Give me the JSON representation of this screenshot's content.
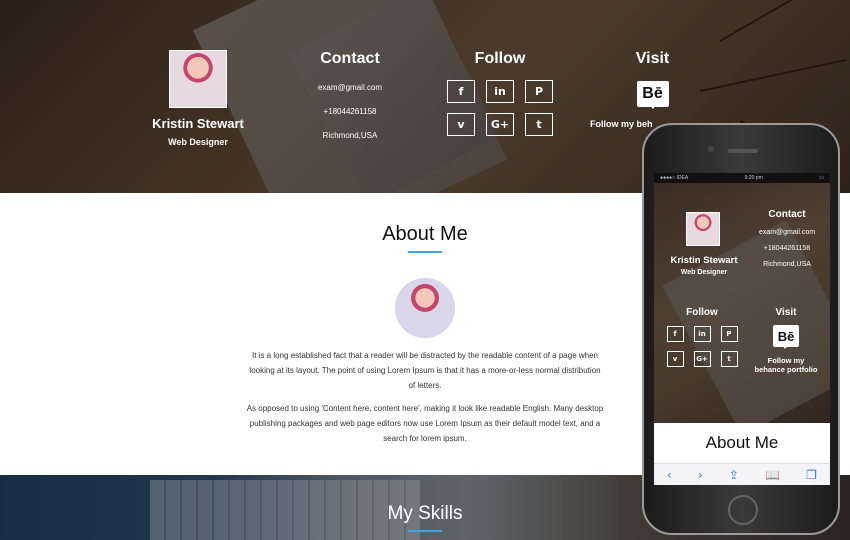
{
  "profile": {
    "name": "Kristin Stewart",
    "role": "Web Designer"
  },
  "contact": {
    "title": "Contact",
    "email": "exam@gmail.com",
    "phone": "+18044261158",
    "location": "Richmond,USA"
  },
  "follow": {
    "title": "Follow",
    "icons": [
      {
        "name": "facebook-icon",
        "glyph": "f"
      },
      {
        "name": "linkedin-icon",
        "glyph": "in"
      },
      {
        "name": "pinterest-icon",
        "glyph": "P"
      },
      {
        "name": "vimeo-icon",
        "glyph": "v"
      },
      {
        "name": "google-plus-icon",
        "glyph": "G+"
      },
      {
        "name": "tumblr-icon",
        "glyph": "t"
      }
    ]
  },
  "visit": {
    "title": "Visit",
    "badge": "Bē",
    "caption": "Follow my behance portfolio",
    "caption_cropped": "Follow my beh"
  },
  "about": {
    "title": "About Me",
    "paragraph1": "It is a long established fact that a reader will be distracted by the readable content of a page when looking at its layout. The point of using Lorem Ipsum is that it has a more-or-less normal distribution of letters.",
    "paragraph2": "As opposed to using 'Content here, content here', making it look like readable English. Many desktop publishing packages and web page editors now use Lorem Ipsum as their default model text, and a search for lorem ipsum."
  },
  "skills": {
    "title": "My Skills"
  },
  "phone": {
    "status_left": "●●●●○ IDEA",
    "status_time": "9:20 pm",
    "mobile_caption_line1": "Follow my",
    "mobile_caption_line2": "behance portfolio",
    "toolbar": [
      "‹",
      "›",
      "⇪",
      "📖",
      "❐"
    ]
  },
  "colors": {
    "accent": "#3ba6e6",
    "hero_dark": "#3a2a1f"
  }
}
